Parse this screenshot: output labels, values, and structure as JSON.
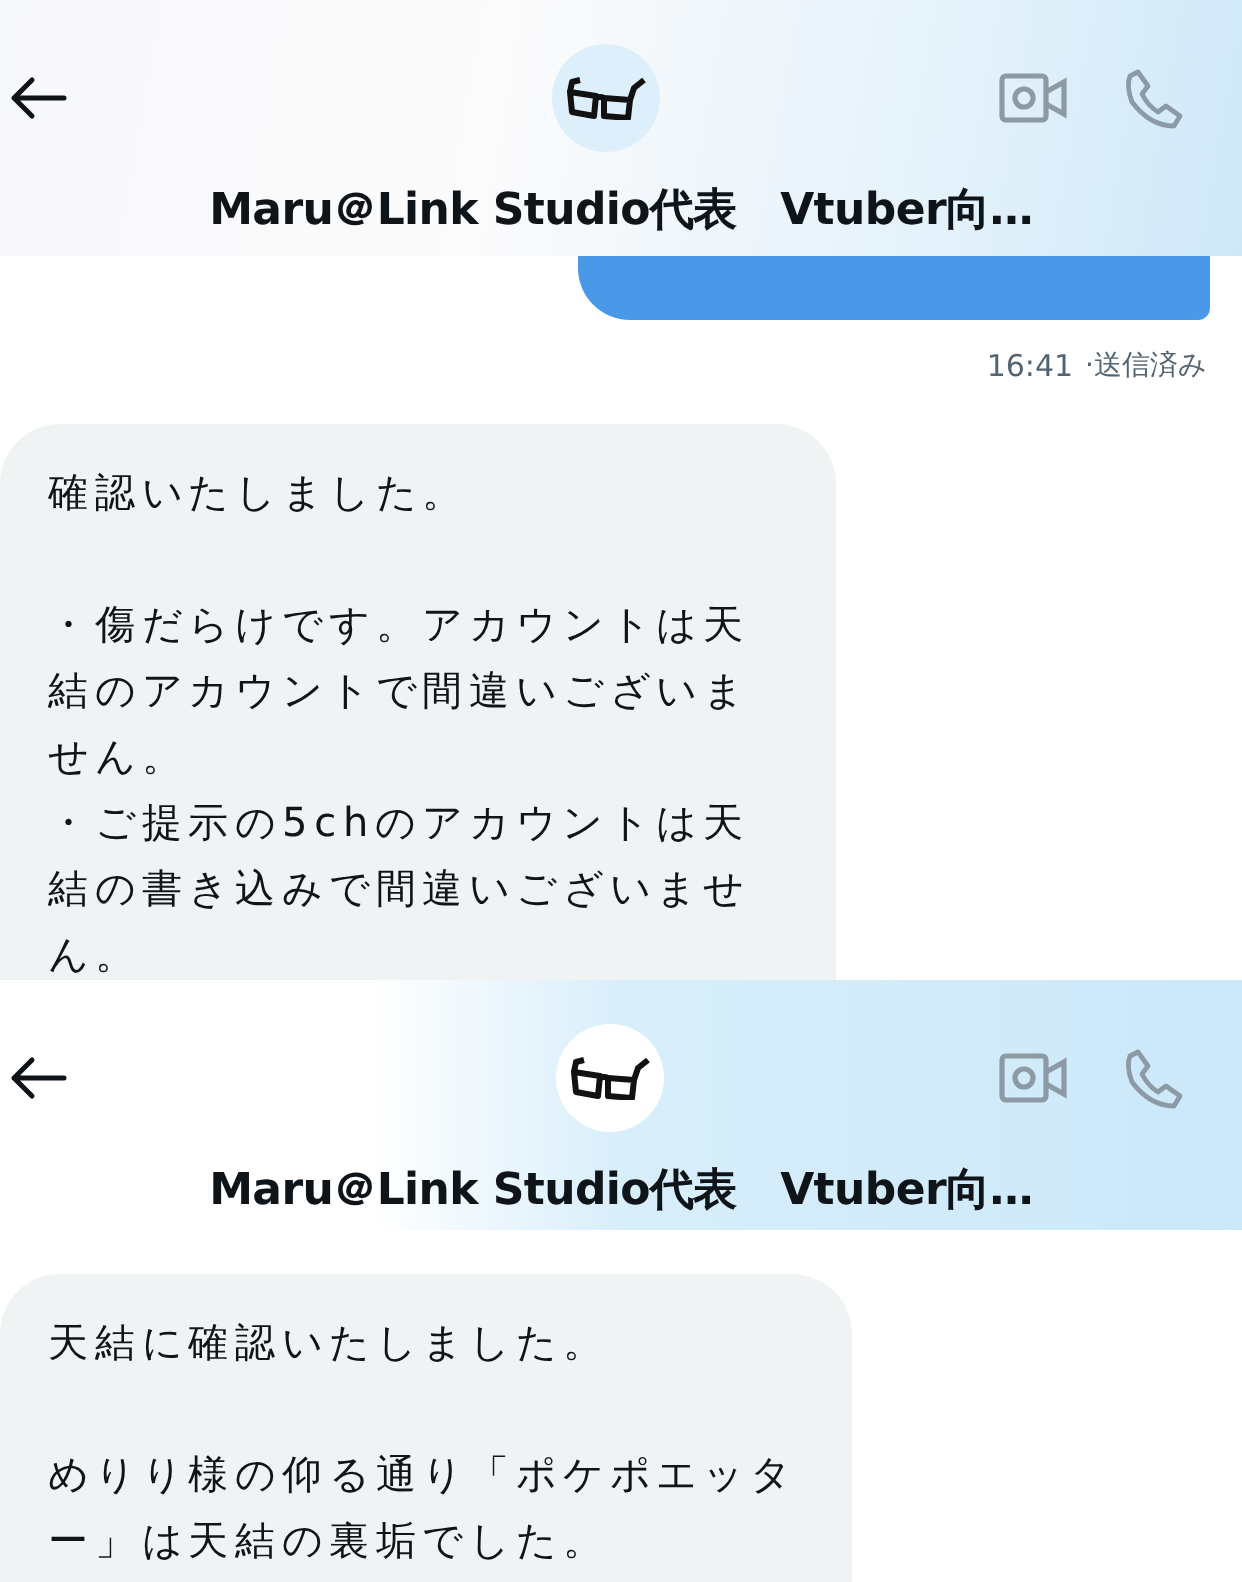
{
  "panels": [
    {
      "header": {
        "title": "Maru＠Link Studio代表　Vtuber向…"
      },
      "messages": [
        {
          "kind": "sent"
        },
        {
          "kind": "meta",
          "time": "16:41",
          "status": "·送信済み"
        },
        {
          "kind": "received",
          "paragraphs": [
            [
              "確認いたしました。"
            ],
            [
              "・傷だらけです。アカウントは天結のアカウントで間違いございません。",
              "・ご提示の5chのアカウントは天結の書き込みで間違いございません。"
            ]
          ]
        }
      ]
    },
    {
      "header": {
        "title": "Maru＠Link Studio代表　Vtuber向…"
      },
      "messages": [
        {
          "kind": "received",
          "paragraphs": [
            [
              "天結に確認いたしました。"
            ],
            [
              "めりり様の仰る通り「ポケポエッター」は天結の裏垢でした。"
            ]
          ]
        }
      ]
    }
  ]
}
